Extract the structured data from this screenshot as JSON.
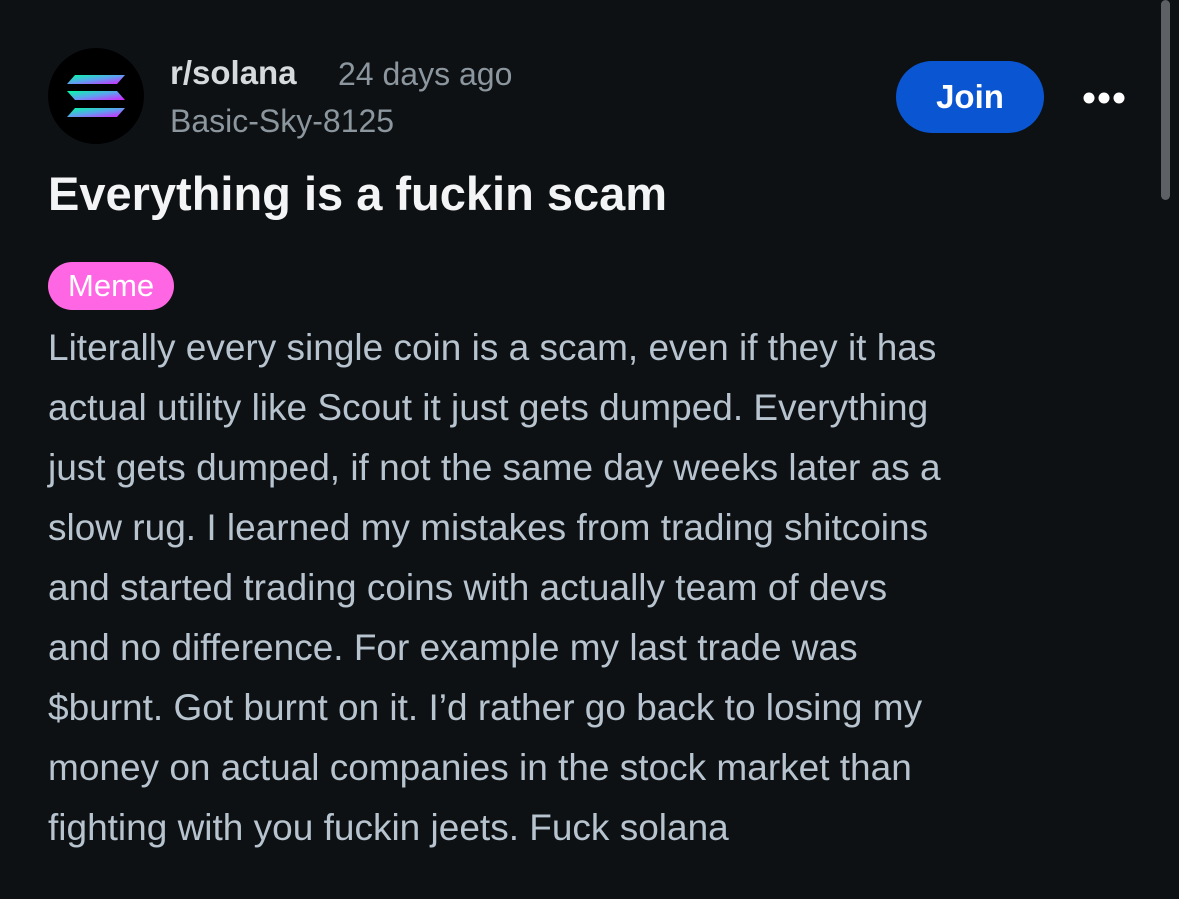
{
  "post": {
    "subreddit": "r/solana",
    "time_ago": "24 days ago",
    "author": "Basic-Sky-8125",
    "join_label": "Join",
    "more_icon": "more-horizontal-icon",
    "title": "Everything is a fuckin scam",
    "flair": "Meme",
    "body_lines": [
      "Literally every single coin is a scam, even if they it has",
      "actual utility like Scout it just gets dumped. Everything",
      "just gets dumped, if not the same day weeks later as a",
      "slow rug. I learned my mistakes from trading shitcoins",
      "and started trading coins with actually team of devs",
      "and no difference. For example my last trade was",
      "$burnt. Got burnt on it. I’d rather go back to losing my",
      "money on actual companies in the stock market than",
      "fighting with you fuckin jeets. Fuck solana"
    ]
  },
  "colors": {
    "background": "#0e1113",
    "join_button": "#0a56d2",
    "flair_background": "#ff66e4",
    "body_text": "#b7c4cf",
    "meta_text": "#8b969e"
  }
}
